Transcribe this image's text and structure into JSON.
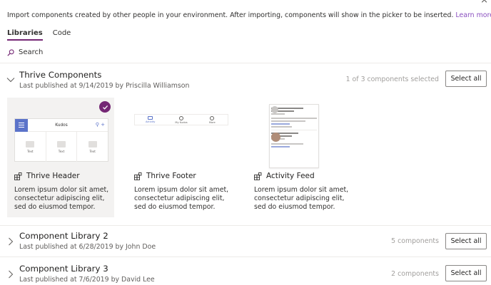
{
  "close_symbol": "×",
  "intro": {
    "text": "Import components created by other people in your environment. After importing, components will show in the picker to be inserted.",
    "link": "Learn more"
  },
  "tabs": [
    {
      "label": "Libraries",
      "active": true
    },
    {
      "label": "Code",
      "active": false
    }
  ],
  "search": {
    "label": "Search"
  },
  "libraries": [
    {
      "title": "Thrive Components",
      "subtitle": "Last published at 9/14/2019 by Priscilla Williamson",
      "count": "1 of 3 components selected",
      "button": "Select all",
      "expanded": true,
      "components": [
        {
          "name": "Thrive Header",
          "description": "Lorem ipsum dolor sit amet, consectetur adipiscing elit, sed do eiusmod tempor.",
          "selected": true,
          "preview": {
            "title": "Kudos",
            "tiles": [
              "Text",
              "Text",
              "Text"
            ]
          }
        },
        {
          "name": "Thrive Footer",
          "description": "Lorem ipsum dolor sit amet, consectetur adipiscing elit, sed do eiusmod tempor.",
          "selected": false,
          "preview": {
            "items": [
              "Activity",
              "My Kudos",
              "More"
            ]
          }
        },
        {
          "name": "Activity Feed",
          "description": "Lorem ipsum dolor sit amet, consectetur adipiscing elit, sed do eiusmod tempor.",
          "selected": false
        }
      ]
    },
    {
      "title": "Component Library 2",
      "subtitle": "Last published at 6/28/2019 by John Doe",
      "count": "5 components",
      "button": "Select all",
      "expanded": false
    },
    {
      "title": "Component Library 3",
      "subtitle": "Last published at 7/6/2019 by David Lee",
      "count": "2 components",
      "button": "Select all",
      "expanded": false
    }
  ],
  "colors": {
    "accent": "#742774",
    "link": "#8a4fbf",
    "preview_blue": "#5b73c9",
    "muted": "#a19f9d",
    "selected_bg": "#f3f2f1"
  },
  "icons": {
    "search": "search-icon",
    "expand": "chevron-down-icon",
    "collapse": "chevron-right-icon",
    "component": "component-icon",
    "check": "checkmark-icon",
    "close": "close-icon"
  }
}
